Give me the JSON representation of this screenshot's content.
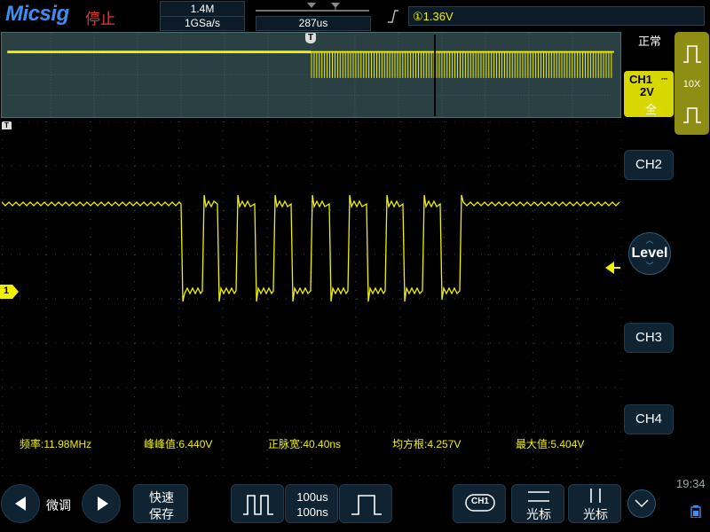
{
  "top": {
    "logo": "Micsig",
    "run_status": "停止",
    "memory_depth": "1.4M",
    "sample_rate": "1GSa/s",
    "time_offset": "287us",
    "trigger_level": "①1.36V"
  },
  "right": {
    "acq_mode": "正常",
    "ch1_label": "CH1",
    "ch1_scale": "2V",
    "ch1_bandwidth": "全",
    "probe": "10X",
    "ch2": "CH2",
    "level": "Level",
    "ch3": "CH3",
    "ch4": "CH4"
  },
  "markers": {
    "trigger": "T",
    "channel": "1"
  },
  "measurements": {
    "freq": "频率:11.98MHz",
    "vpp": "峰峰值:6.440V",
    "pwidth": "正脉宽:40.40ns",
    "vrms": "均方根:4.257V",
    "vmax": "最大值:5.404V"
  },
  "bottom": {
    "fine_label": "微调",
    "quick_save_1": "快速",
    "quick_save_2": "保存",
    "timebase_1": "100us",
    "timebase_2": "100ns",
    "ch1_chip": "CH1",
    "cursor_h": "光标",
    "cursor_v": "光标",
    "clock": "19:34"
  },
  "colors": {
    "trace": "#f0f000",
    "accent": "#3d8ef0",
    "panel": "#0f2332"
  },
  "waveform": {
    "pulse_count": 7,
    "unit": "normalized"
  }
}
